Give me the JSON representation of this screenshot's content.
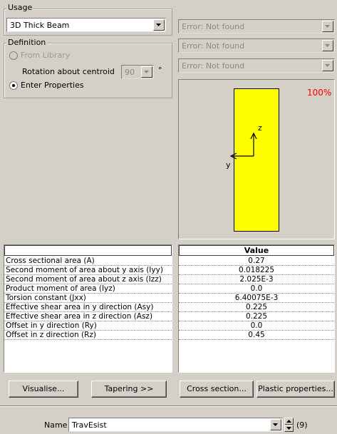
{
  "left": {
    "usage_legend": "Usage",
    "usage_value": "3D Thick Beam",
    "definition_legend": "Definition",
    "from_library_label": "From Library",
    "rotation_label": "Rotation about centroid",
    "rotation_value": "90",
    "rotation_unit": "°",
    "enter_properties_label": "Enter Properties",
    "selected_mode": "Enter Properties"
  },
  "right": {
    "combos": [
      "Error: Not found",
      "Error: Not found",
      "Error: Not found"
    ],
    "preview": {
      "zoom_label": "100%",
      "axis_y": "y",
      "axis_z": "z",
      "section_color": "#ffff00",
      "zoom_color": "#ff0000"
    }
  },
  "properties": {
    "value_header": "Value",
    "rows": [
      {
        "label": "Cross sectional area (A)",
        "value": "0.27"
      },
      {
        "label": "Second moment of area about y axis (Iyy)",
        "value": "0.018225"
      },
      {
        "label": "Second moment of area about z axis (Izz)",
        "value": "2.025E-3"
      },
      {
        "label": "Product moment of area (Iyz)",
        "value": "0.0"
      },
      {
        "label": "Torsion constant (Jxx)",
        "value": "6.40075E-3"
      },
      {
        "label": "Effective shear area in y direction (Asy)",
        "value": "0.225"
      },
      {
        "label": "Effective shear area in z direction (Asz)",
        "value": "0.225"
      },
      {
        "label": "Offset in y direction (Ry)",
        "value": "0.0"
      },
      {
        "label": "Offset in z direction (Rz)",
        "value": "0.45"
      }
    ]
  },
  "buttons": {
    "visualise": "Visualise...",
    "tapering": "Tapering >>",
    "cross_section": "Cross section...",
    "plastic_properties": "Plastic properties..."
  },
  "footer": {
    "name_label": "Name",
    "name_value": "TravEsist",
    "count": "(9)"
  }
}
